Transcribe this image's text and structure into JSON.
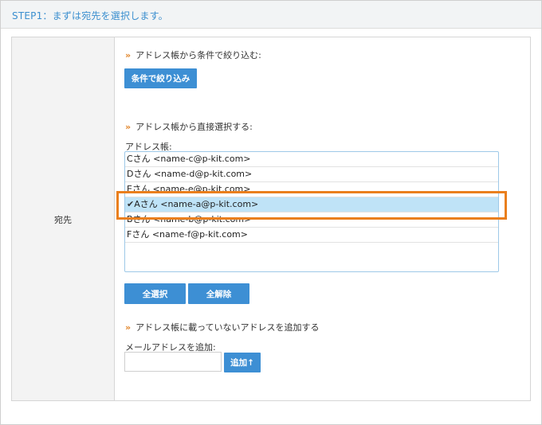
{
  "step_header": {
    "title": "STEP1：まずは宛先を選択します。"
  },
  "form": {
    "row_label": "宛先",
    "filter_section": {
      "heading": "アドレス帳から条件で絞り込む:",
      "button_label": "条件で絞り込み"
    },
    "direct_section": {
      "heading": "アドレス帳から直接選択する:",
      "list_label": "アドレス帳:",
      "items": [
        {
          "text": "Cさん <name-c@p-kit.com>",
          "selected": false
        },
        {
          "text": "Dさん <name-d@p-kit.com>",
          "selected": false
        },
        {
          "text": "Eさん <name-e@p-kit.com>",
          "selected": false
        },
        {
          "text": "Aさん <name-a@p-kit.com>",
          "selected": true,
          "check": "✔"
        },
        {
          "text": "Bさん <name-b@p-kit.com>",
          "selected": false
        },
        {
          "text": "Fさん <name-f@p-kit.com>",
          "selected": false
        }
      ],
      "select_all_label": "全選択",
      "deselect_all_label": "全解除"
    },
    "add_section": {
      "heading": "アドレス帳に載っていないアドレスを追加する",
      "input_label": "メールアドレスを追加:",
      "input_value": "",
      "add_button_label": "追加↑"
    },
    "heading_mark": "»"
  },
  "colors": {
    "accent_blue": "#3d8fd4",
    "heading_mark_orange": "#e2862b",
    "highlight_orange": "#ea7f1d",
    "selected_row": "#bfe3f7"
  }
}
